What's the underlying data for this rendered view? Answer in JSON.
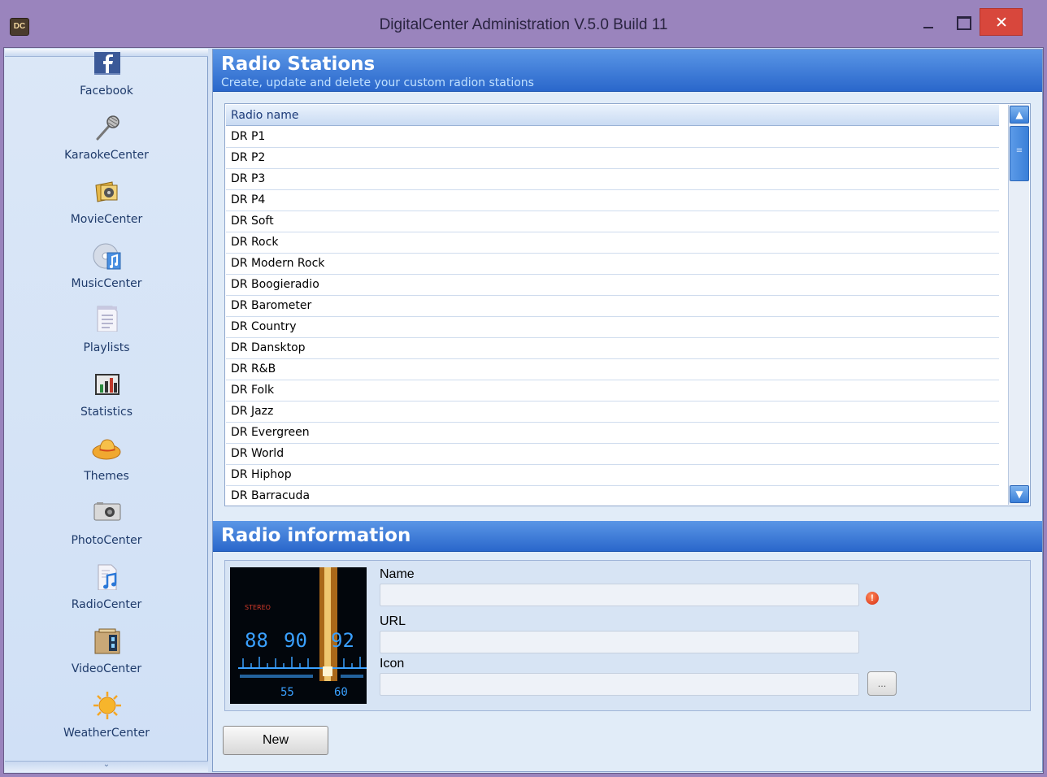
{
  "window": {
    "title": "DigitalCenter Administration V.5.0 Build 11",
    "app_icon_text": "DC"
  },
  "sidebar": {
    "items": [
      {
        "label": "Facebook",
        "icon": "facebook-icon"
      },
      {
        "label": "KaraokeCenter",
        "icon": "microphone-icon"
      },
      {
        "label": "MovieCenter",
        "icon": "film-icon"
      },
      {
        "label": "MusicCenter",
        "icon": "cd-music-icon"
      },
      {
        "label": "Playlists",
        "icon": "document-list-icon"
      },
      {
        "label": "Statistics",
        "icon": "bar-chart-icon"
      },
      {
        "label": "Themes",
        "icon": "cowboy-hat-icon"
      },
      {
        "label": "PhotoCenter",
        "icon": "camera-icon"
      },
      {
        "label": "RadioCenter",
        "icon": "music-document-icon"
      },
      {
        "label": "VideoCenter",
        "icon": "video-box-icon"
      },
      {
        "label": "WeatherCenter",
        "icon": "sun-icon"
      }
    ]
  },
  "radio_stations": {
    "title": "Radio Stations",
    "subtitle": "Create, update and delete your custom radion stations",
    "column_header": "Radio name",
    "rows": [
      "DR P1",
      "DR P2",
      "DR P3",
      "DR P4",
      "DR Soft",
      "DR Rock",
      "DR Modern Rock",
      "DR Boogieradio",
      "DR Barometer",
      "DR Country",
      "DR Dansktop",
      "DR R&B",
      "DR Folk",
      "DR Jazz",
      "DR Evergreen",
      "DR World",
      "DR Hiphop",
      "DR Barracuda"
    ]
  },
  "radio_information": {
    "title": "Radio information",
    "image_text": {
      "stereo": "STEREO",
      "dial_numbers": [
        "88",
        "90",
        "92",
        "55",
        "60"
      ]
    },
    "fields": {
      "name_label": "Name",
      "name_value": "",
      "url_label": "URL",
      "url_value": "",
      "icon_label": "Icon",
      "icon_value": ""
    },
    "browse_label": "...",
    "error_indicator": "!"
  },
  "actions": {
    "new_label": "New"
  },
  "colors": {
    "header_blue": "#2a67cb",
    "close_red": "#d8473c",
    "titlebar_purple": "#9a84bd"
  }
}
